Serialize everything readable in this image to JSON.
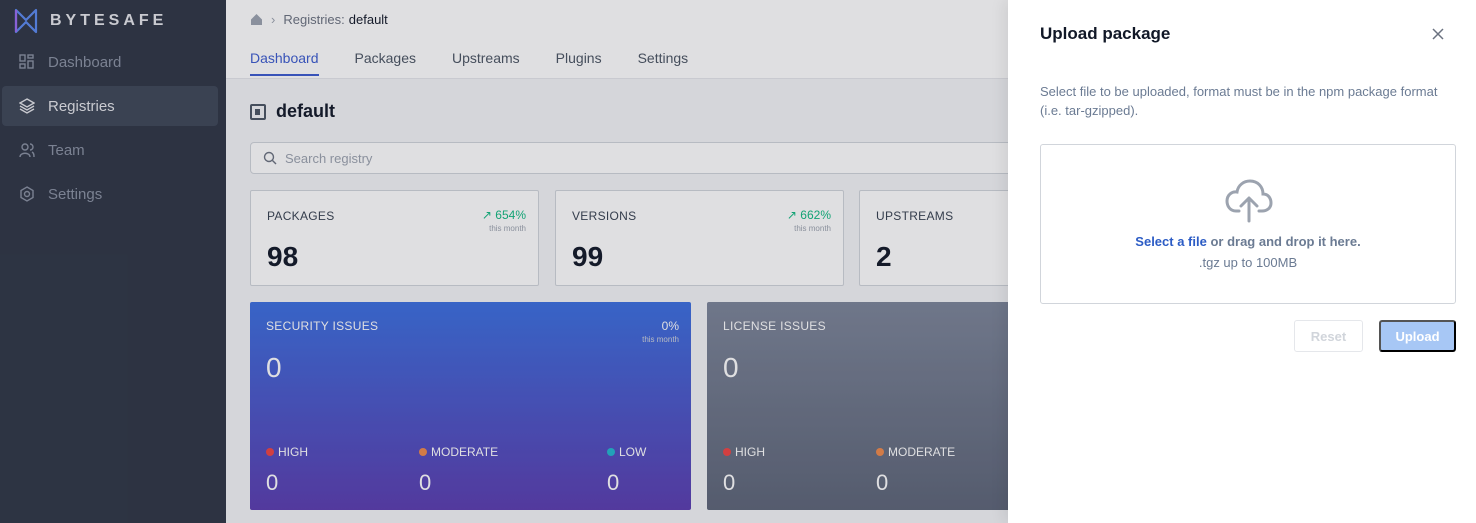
{
  "brand": {
    "name": "BYTESAFE"
  },
  "sidebar": {
    "items": [
      {
        "label": "Dashboard",
        "icon": "dashboard-icon",
        "active": false
      },
      {
        "label": "Registries",
        "icon": "layers-icon",
        "active": true
      },
      {
        "label": "Team",
        "icon": "team-icon",
        "active": false
      },
      {
        "label": "Settings",
        "icon": "gear-icon",
        "active": false
      }
    ]
  },
  "breadcrumb": {
    "parent": "Registries:",
    "current": "default"
  },
  "tabs": [
    {
      "label": "Dashboard",
      "active": true
    },
    {
      "label": "Packages",
      "active": false
    },
    {
      "label": "Upstreams",
      "active": false
    },
    {
      "label": "Plugins",
      "active": false
    },
    {
      "label": "Settings",
      "active": false
    }
  ],
  "page": {
    "title": "default"
  },
  "search": {
    "placeholder": "Search registry"
  },
  "stats": [
    {
      "label": "PACKAGES",
      "value": "98",
      "trend": "654%",
      "trend_note": "this month"
    },
    {
      "label": "VERSIONS",
      "value": "99",
      "trend": "662%",
      "trend_note": "this month"
    },
    {
      "label": "UPSTREAMS",
      "value": "2"
    }
  ],
  "security": {
    "label": "SECURITY ISSUES",
    "value": "0",
    "trend": "0%",
    "trend_note": "this month",
    "high_label": "HIGH",
    "high": "0",
    "moderate_label": "MODERATE",
    "moderate": "0",
    "low_label": "LOW",
    "low": "0"
  },
  "license": {
    "label": "LICENSE ISSUES",
    "value": "0",
    "high_label": "HIGH",
    "high": "0",
    "moderate_label": "MODERATE",
    "moderate": "0"
  },
  "drawer": {
    "title": "Upload package",
    "description": "Select file to be uploaded, format must be in the npm package format (i.e. tar-gzipped).",
    "select_link": "Select a file",
    "drop_text": " or drag and drop it here.",
    "drop_sub": ".tgz up to 100MB",
    "reset_label": "Reset",
    "upload_label": "Upload"
  },
  "colors": {
    "accent": "#3b5bcf",
    "sidebar": "#2e3545",
    "trend_up": "#10b981",
    "high": "#ef4444",
    "moderate": "#f08a4b",
    "low": "#22b8cf"
  }
}
